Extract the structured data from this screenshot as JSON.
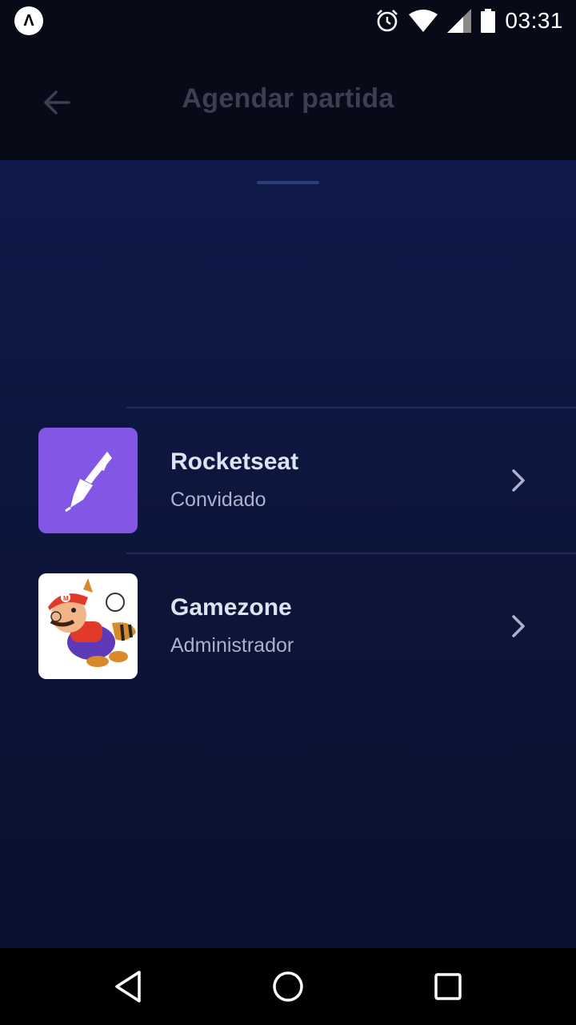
{
  "status_bar": {
    "app_badge": "Λ",
    "time": "03:31",
    "icons": [
      "alarm-icon",
      "wifi-icon",
      "signal-icon",
      "battery-icon"
    ]
  },
  "header": {
    "title": "Agendar partida",
    "back_icon": "arrow-left-icon"
  },
  "guilds": [
    {
      "name": "Rocketseat",
      "role": "Convidado",
      "icon": "rocketseat-logo",
      "icon_bg": "#8257e5"
    },
    {
      "name": "Gamezone",
      "role": "Administrador",
      "icon": "mario-avatar",
      "icon_bg": "#ffffff"
    }
  ],
  "nav_bar": {
    "buttons": [
      "back-triangle-icon",
      "home-circle-icon",
      "recents-square-icon"
    ]
  },
  "colors": {
    "background": "#0a1030",
    "header_bg": "#080a17",
    "title_text": "#3a3f52",
    "name_text": "#dde3f0",
    "role_text": "#abb1cc",
    "accent": "#8257e5"
  }
}
